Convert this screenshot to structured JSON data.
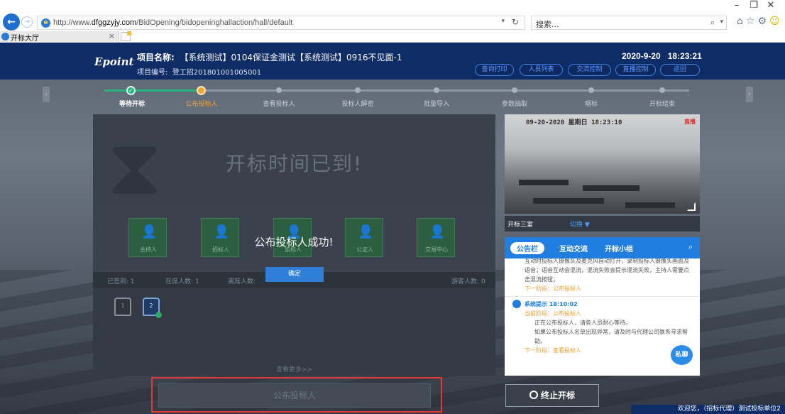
{
  "browser": {
    "url_prefix": "http://www.",
    "url_domain": "dfggzyjy.com",
    "url_path": "/BidOpening/bidopeninghallaction/hall/default",
    "search_text": "搜索...",
    "tab_title": "开标大厅",
    "tab_close": "×"
  },
  "header": {
    "logo": "Epoint",
    "project_name_label": "项目名称:",
    "project_name": "【系统测试】0104保证金测试【系统测试】0916不见面-1",
    "project_no_label": "项目编号:",
    "project_no": "登工招201801001005001",
    "date": "2020-9-20",
    "time": "18:23:21",
    "buttons": [
      "查询打印",
      "人员列表",
      "交流控制",
      "直播控制",
      "返回"
    ]
  },
  "steps": [
    "等待开标",
    "公布投标人",
    "查看投标人",
    "投标人解密",
    "批量导入",
    "参数抽取",
    "唱标",
    "开标结束"
  ],
  "main": {
    "banner": "开标时间已到!",
    "roles": [
      "主持人",
      "招标人",
      "监标人",
      "公证人",
      "交易中心"
    ],
    "stats": {
      "signed": "已签到: 1",
      "present": "在席人数: 1",
      "absent": "离席人数:",
      "guests": "游客人数: 0"
    },
    "seats": [
      "1",
      "2"
    ],
    "more": "查看更多>>",
    "publish_button": "公布投标人"
  },
  "dialog": {
    "message": "公布投标人成功!",
    "ok": "确定"
  },
  "video": {
    "timestamp": "09-20-2020 星期日 18:23:10",
    "rec": "直播"
  },
  "room": {
    "name": "开标三室",
    "switch": "切换 ▼"
  },
  "notice": {
    "tabs": [
      "公告栏",
      "互动交流",
      "开标小组"
    ],
    "prev_text": "互动时投标人摄像头及麦克风自动打开，录制投标人摄像头画面及语音；语音互动会混流，混流失败会提示混流失败，主持人需要点击混流按钮；",
    "prev_next": "下一阶段：公布投标人",
    "sys_title": "系统提示 18:10:02",
    "sys_stage": "当前阶段：公布投标人",
    "sys_line1": "正在公布投标人，请各人员耐心等待。",
    "sys_line2": "如果公布投标人名单出现异常，请及时与代理公司联系寻求帮助。",
    "sys_next": "下一阶段：查看投标人"
  },
  "chat": "私聊",
  "stop_button": "终止开标",
  "welcome": "欢迎您，（招标代理）测试投标单位2",
  "colors": {
    "header_bg": "#0e2c66",
    "done": "#29b37a",
    "current": "#f2a531",
    "accent": "#1f7ee0",
    "highlight": "#e53a3a"
  }
}
